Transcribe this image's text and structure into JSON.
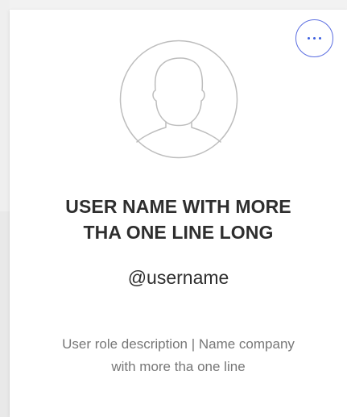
{
  "card": {
    "menu_icon": "more-horizontal-icon",
    "avatar_icon": "user-avatar-placeholder-icon",
    "name_line_1": "USER NAME WITH MORE",
    "name_line_2": "THA ONE LINE LONG",
    "username": "@username",
    "role_line_1": "User role description | Name company",
    "role_line_2": "with more tha one line"
  },
  "colors": {
    "accent": "#3d5fe0",
    "text_primary": "#2e2e2e",
    "text_secondary": "#777777",
    "avatar_stroke": "#bdbdbd"
  }
}
